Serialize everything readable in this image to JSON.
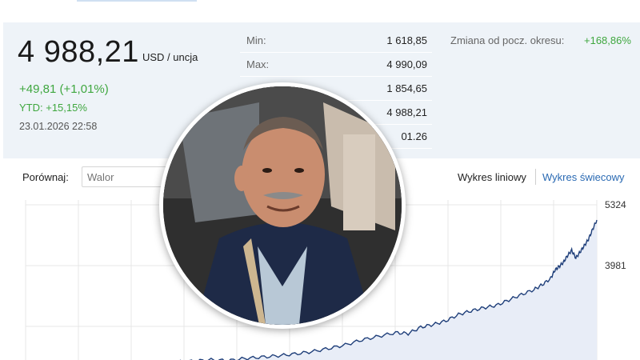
{
  "quote": {
    "price": "4 988,21",
    "unit": "USD / uncja",
    "change": "+49,81 (+1,01%)",
    "ytd": "YTD: +15,15%",
    "datetime": "23.01.2026 22:58"
  },
  "stats": [
    {
      "label": "Min:",
      "value": "1 618,85"
    },
    {
      "label": "Max:",
      "value": "4 990,09"
    },
    {
      "label": "",
      "value": "1 854,65"
    },
    {
      "label": "",
      "value": "4 988,21"
    },
    {
      "label": "",
      "value": "01.26"
    }
  ],
  "period_change": {
    "label": "Zmiana od pocz. okresu:",
    "value": "+168,86%"
  },
  "compare": {
    "label": "Porównaj:",
    "placeholder": "Walor"
  },
  "chart_tabs": {
    "line": "Wykres liniowy",
    "candle": "Wykres świecowy"
  },
  "chart_data": {
    "type": "area",
    "title": "",
    "xlabel": "",
    "ylabel": "",
    "y_ticks": [
      5324,
      3981
    ],
    "line_color": "#1f3f7a",
    "fill_color": "#e8edf7",
    "points": [
      [
        0,
        1854
      ],
      [
        0.04,
        1870
      ],
      [
        0.08,
        1900
      ],
      [
        0.12,
        1880
      ],
      [
        0.16,
        1930
      ],
      [
        0.2,
        1960
      ],
      [
        0.24,
        1990
      ],
      [
        0.28,
        2030
      ],
      [
        0.32,
        2080
      ],
      [
        0.36,
        2150
      ],
      [
        0.4,
        2230
      ],
      [
        0.44,
        2340
      ],
      [
        0.48,
        2420
      ],
      [
        0.52,
        2500
      ],
      [
        0.55,
        2480
      ],
      [
        0.58,
        2620
      ],
      [
        0.61,
        2680
      ],
      [
        0.64,
        2760
      ],
      [
        0.67,
        2900
      ],
      [
        0.7,
        2980
      ],
      [
        0.73,
        3050
      ],
      [
        0.76,
        3100
      ],
      [
        0.79,
        3220
      ],
      [
        0.82,
        3340
      ],
      [
        0.85,
        3450
      ],
      [
        0.87,
        3560
      ],
      [
        0.89,
        3700
      ],
      [
        0.9,
        3880
      ],
      [
        0.91,
        3960
      ],
      [
        0.92,
        4050
      ],
      [
        0.93,
        4200
      ],
      [
        0.94,
        4320
      ],
      [
        0.95,
        4150
      ],
      [
        0.96,
        4280
      ],
      [
        0.97,
        4420
      ],
      [
        0.98,
        4560
      ],
      [
        0.99,
        4780
      ],
      [
        1.0,
        4988
      ]
    ]
  },
  "portrait": {
    "skin": "#c98d6f",
    "suit": "#1e2a47",
    "shirt": "#b8c8d6"
  }
}
